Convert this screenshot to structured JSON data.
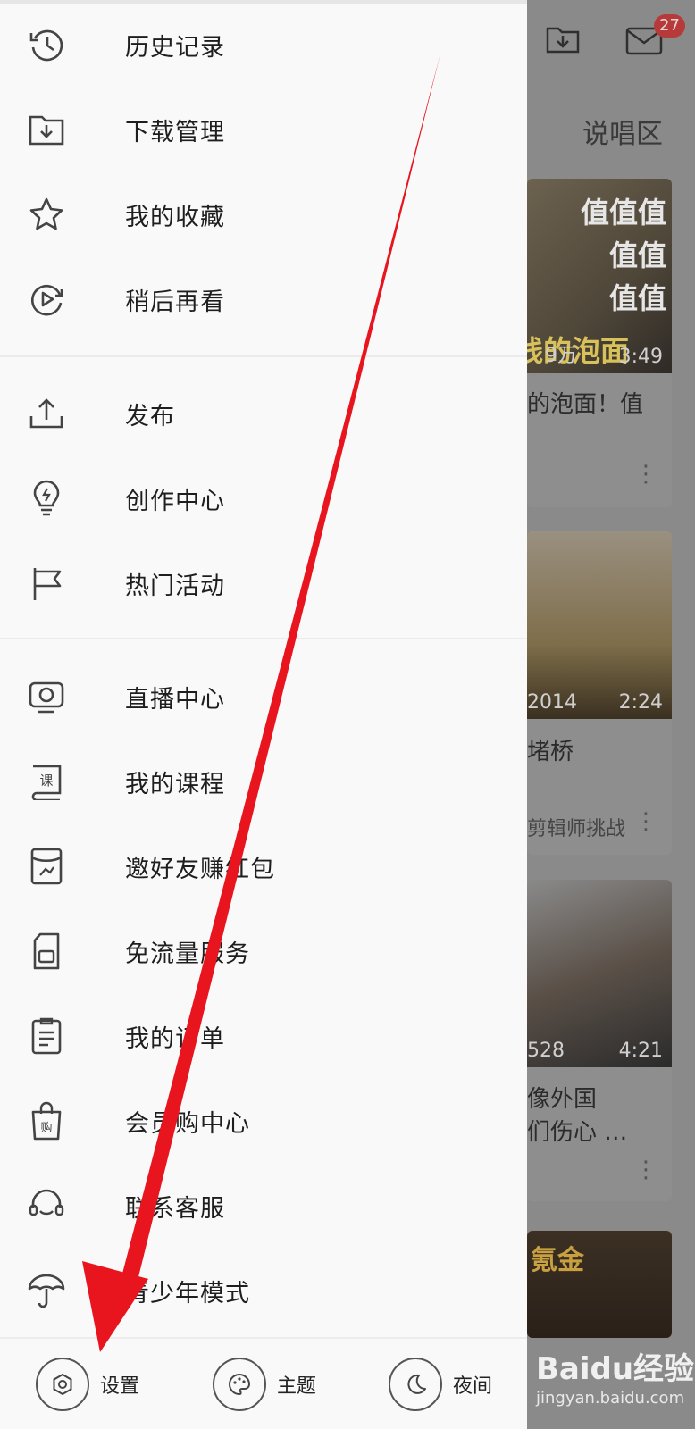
{
  "background": {
    "badge_count": "27",
    "tab_label": "说唱区",
    "cards": [
      {
        "overlay_lines": [
          "值值值",
          "值值",
          "值值"
        ],
        "bottom_caption": "线的泡面",
        "views": "9万",
        "duration": "3:49",
        "title": "的泡面！值"
      },
      {
        "views": "2014",
        "duration": "2:24",
        "title": "堵桥",
        "subtitle": "剪辑师挑战"
      },
      {
        "views": "528",
        "duration": "4:21",
        "title_line1": "像外国",
        "title_line2": "们伤心 …"
      },
      {
        "overlay_text": "氪金"
      }
    ],
    "watermark": "Baidu经验",
    "watermark_url": "jingyan.baidu.com"
  },
  "drawer": {
    "group1": [
      {
        "label": "历史记录",
        "icon": "history-icon"
      },
      {
        "label": "下载管理",
        "icon": "download-folder-icon"
      },
      {
        "label": "我的收藏",
        "icon": "star-icon"
      },
      {
        "label": "稍后再看",
        "icon": "watch-later-icon"
      }
    ],
    "group2": [
      {
        "label": "发布",
        "icon": "upload-icon"
      },
      {
        "label": "创作中心",
        "icon": "lightbulb-icon"
      },
      {
        "label": "热门活动",
        "icon": "flag-icon"
      }
    ],
    "group3": [
      {
        "label": "直播中心",
        "icon": "live-tv-icon"
      },
      {
        "label": "我的课程",
        "icon": "course-book-icon"
      },
      {
        "label": "邀好友赚红包",
        "icon": "red-envelope-icon"
      },
      {
        "label": "免流量服务",
        "icon": "sim-card-icon"
      },
      {
        "label": "我的订单",
        "icon": "order-clipboard-icon"
      },
      {
        "label": "会员购中心",
        "icon": "shopping-bag-icon"
      },
      {
        "label": "联系客服",
        "icon": "headset-icon"
      },
      {
        "label": "青少年模式",
        "icon": "umbrella-icon"
      }
    ],
    "bottom": {
      "settings": "设置",
      "theme": "主题",
      "night": "夜间"
    }
  },
  "colors": {
    "annotation_arrow": "#e8141e",
    "drawer_bg": "#f9f9f9",
    "badge": "#b63a3a"
  }
}
